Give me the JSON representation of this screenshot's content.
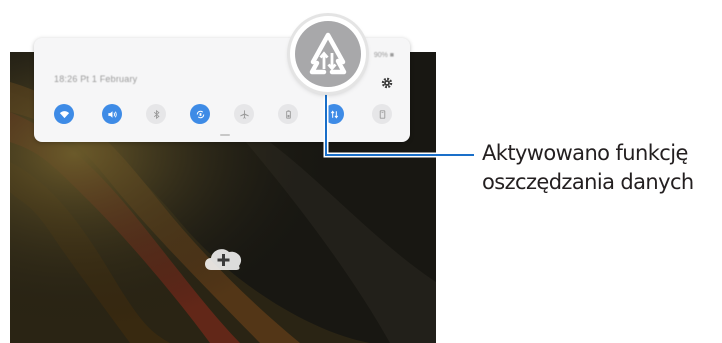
{
  "quick_panel": {
    "datetime": "18:26 Pt 1 February",
    "status": "90% ■",
    "tiles": [
      {
        "icon": "wifi-icon",
        "state": "on"
      },
      {
        "icon": "sound-icon",
        "state": "on"
      },
      {
        "icon": "bluetooth-icon",
        "state": "off"
      },
      {
        "icon": "auto-rotate-icon",
        "state": "on"
      },
      {
        "icon": "airplane-mode-icon",
        "state": "off"
      },
      {
        "icon": "power-saving-icon",
        "state": "off"
      },
      {
        "icon": "data-saver-icon",
        "state": "on"
      },
      {
        "icon": "book-icon",
        "state": "off"
      }
    ]
  },
  "callout": {
    "icon": "data-saver-icon",
    "line1": "Aktywowano funkcję",
    "line2": "oszczędzania danych"
  },
  "home": {
    "add_icon": "cloud-add-icon"
  },
  "colors": {
    "accent": "#3e8be6",
    "tile_off": "#e6e6e8",
    "callout_line": "#1a6fc9",
    "text": "#231f20"
  }
}
